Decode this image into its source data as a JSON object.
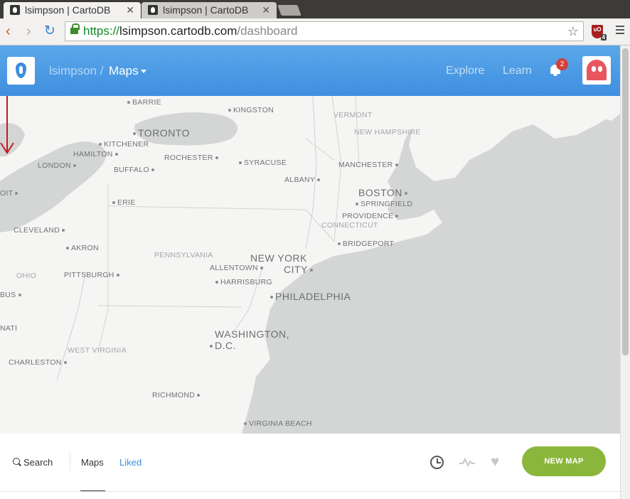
{
  "browser": {
    "tabs": [
      {
        "title": "lsimpson | CartoDB",
        "active": true
      },
      {
        "title": "lsimpson | CartoDB",
        "active": false
      }
    ],
    "url": {
      "scheme": "https://",
      "host": "lsimpson.cartodb.com",
      "path": "/dashboard"
    },
    "extension_badge": "4",
    "extension_label": "uO"
  },
  "header": {
    "username": "lsimpson /",
    "section": "Maps",
    "nav": {
      "explore": "Explore",
      "learn": "Learn"
    },
    "notifications_count": "2",
    "colors": {
      "bar": "#4a99e5",
      "avatar": "#e8555d"
    }
  },
  "map": {
    "cities_major": [
      "TORONTO",
      "BOSTON",
      "NEW YORK",
      "CITY",
      "PHILADELPHIA",
      "WASHINGTON,",
      "D.C."
    ],
    "cities": [
      "BARRIE",
      "KINGSTON",
      "KITCHENER",
      "HAMILTON",
      "ROCHESTER",
      "SYRACUSE",
      "LONDON",
      "BUFFALO",
      "ALBANY",
      "MANCHESTER",
      "SPRINGFIELD",
      "PROVIDENCE",
      "ERIE",
      "CLEVELAND",
      "AKRON",
      "BRIDGEPORT",
      "ALLENTOWN",
      "PITTSBURGH",
      "HARRISBURG",
      "CHARLESTON",
      "RICHMOND",
      "VIRGINIA BEACH",
      "OIT",
      "BUS",
      "NATI"
    ],
    "states": [
      "VERMONT",
      "NEW HAMPSHIRE",
      "CONNECTICUT",
      "PENNSYLVANIA",
      "OHIO",
      "WEST VIRGINIA"
    ]
  },
  "filters": {
    "search": "Search",
    "maps": "Maps",
    "liked": "Liked",
    "new_map": "NEW MAP",
    "accent": "#8bb63c"
  }
}
